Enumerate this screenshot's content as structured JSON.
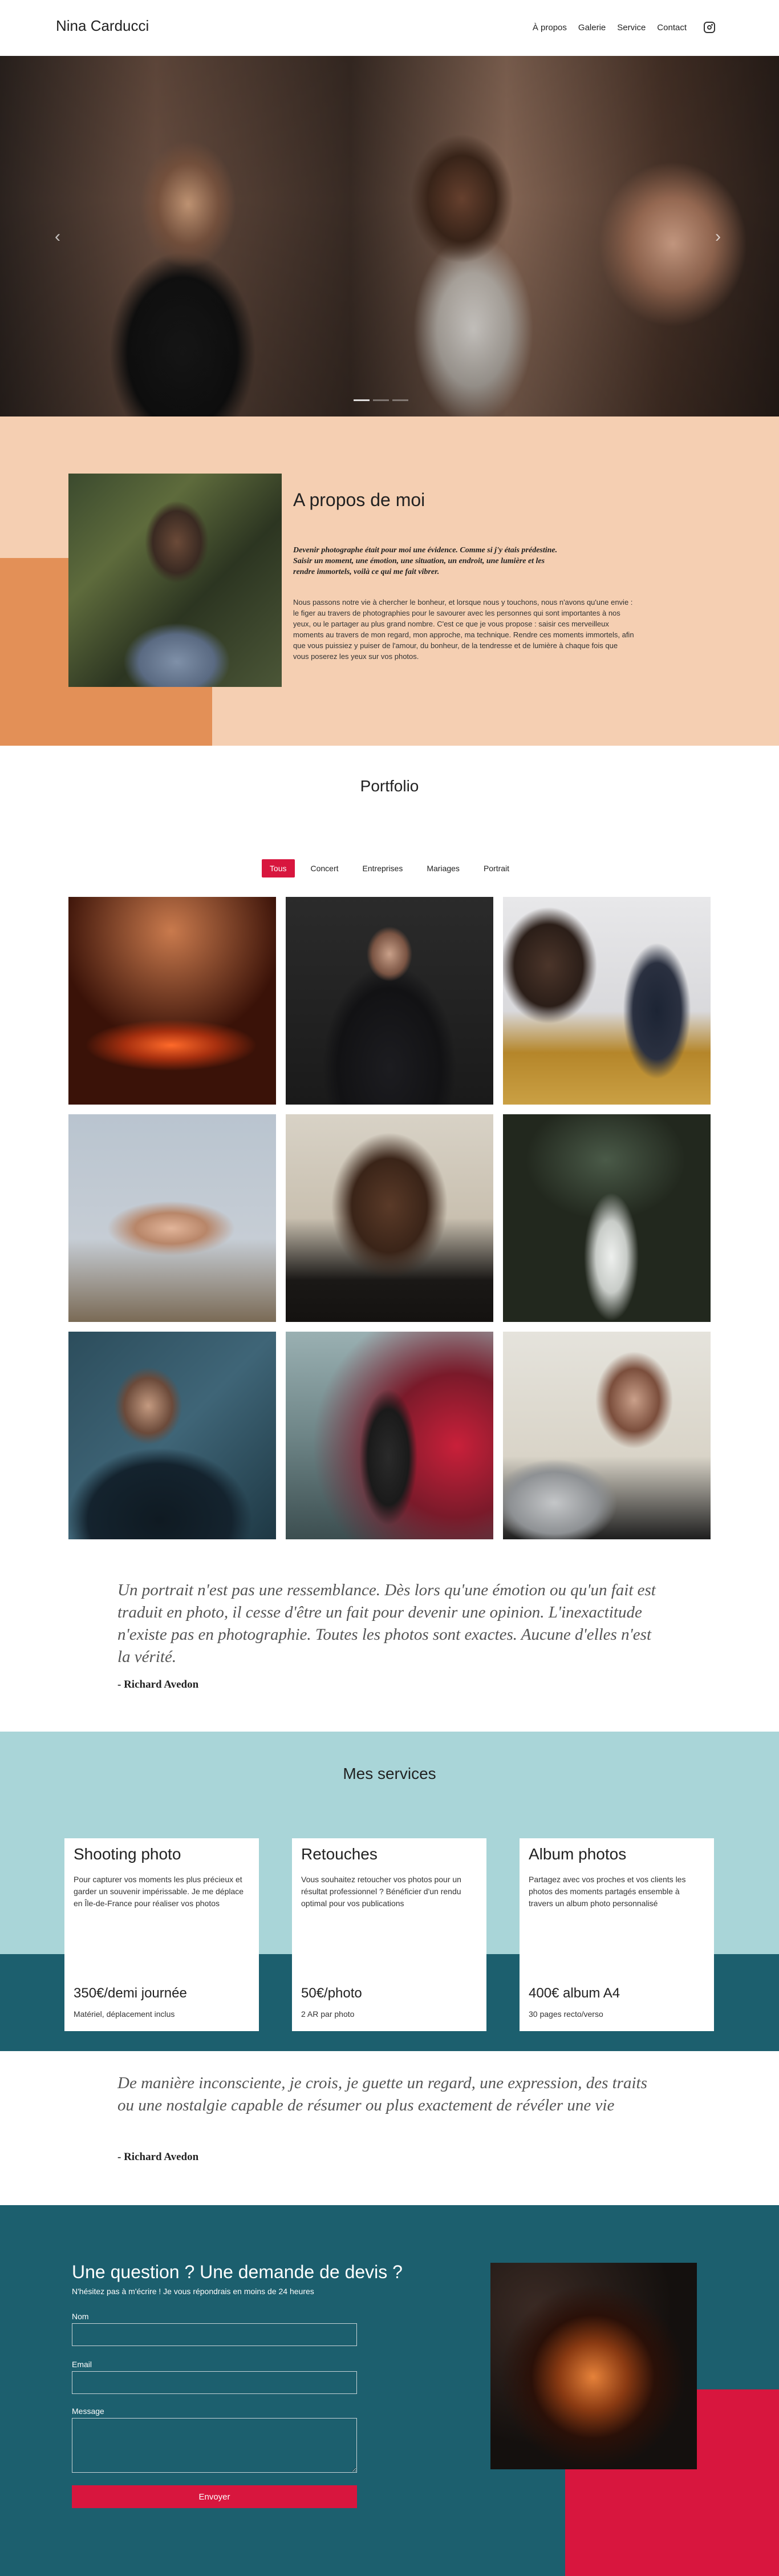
{
  "header": {
    "brand": "Nina Carducci",
    "nav": [
      "À propos",
      "Galerie",
      "Service",
      "Contact"
    ],
    "instagram_icon": "instagram-icon"
  },
  "hero": {
    "prev_icon": "‹",
    "next_icon": "›",
    "slides": 3,
    "active_slide": 1
  },
  "about": {
    "title": "A propos de moi",
    "lead": "Devenir photographe était pour moi une évidence. Comme si j'y étais prédestine. Saisir un moment, une émotion, une situation, un endroit, une lumière et les rendre immortels, voilà ce qui me fait vibrer.",
    "body": "Nous passons notre vie à chercher le bonheur, et lorsque nous y touchons, nous n'avons qu'une envie : le figer au travers de photographies pour le savourer avec les personnes qui sont importantes à nos yeux, ou le partager au plus grand nombre. C'est ce que je vous propose : saisir ces merveilleux moments au travers de mon regard, mon approche, ma technique. Rendre ces moments immortels, afin que vous puissiez y puiser de l'amour, du bonheur, de la tendresse et de lumière à chaque fois que vous poserez les yeux sur vos photos."
  },
  "portfolio": {
    "title": "Portfolio",
    "filters": [
      "Tous",
      "Concert",
      "Entreprises",
      "Mariages",
      "Portrait"
    ],
    "active_filter": "Tous"
  },
  "quote1": {
    "text": "Un portrait n'est pas une ressemblance. Dès lors qu'une émotion ou qu'un fait est traduit en photo, il cesse d'être un fait pour devenir une opinion. L'inexactitude n'existe pas en photographie. Toutes les photos sont exactes. Aucune d'elles n'est la vérité.",
    "author": "- Richard Avedon"
  },
  "services": {
    "title": "Mes services",
    "cards": [
      {
        "title": "Shooting photo",
        "text": "Pour capturer vos moments les plus précieux et garder un souvenir impérissable. Je me déplace en Île-de-France pour réaliser vos photos",
        "price": "350€/demi journée",
        "sub": "Matériel, déplacement inclus"
      },
      {
        "title": "Retouches",
        "text": "Vous souhaitez retoucher vos photos pour un résultat professionnel ? Bénéficier d'un rendu optimal pour vos publications",
        "price": "50€/photo",
        "sub": "2 AR par photo"
      },
      {
        "title": "Album photos",
        "text": "Partagez avec vos proches et vos clients les photos des moments partagés ensemble à travers un album photo personnalisé",
        "price": "400€ album A4",
        "sub": "30 pages recto/verso"
      }
    ]
  },
  "quote2": {
    "text": "De manière inconsciente, je crois, je guette un regard, une expression, des traits ou une nostalgie capable de résumer ou plus exactement de révéler une vie",
    "author": "- Richard Avedon"
  },
  "contact": {
    "title": "Une question ? Une demande de devis ?",
    "subtitle": "N'hésitez pas à m'écrire ! Je vous répondrais en moins de 24 heures",
    "name_label": "Nom",
    "email_label": "Email",
    "message_label": "Message",
    "submit": "Envoyer"
  },
  "colors": {
    "accent": "#d8163e",
    "teal": "#1c5f6e",
    "peach": "#f5cfb2",
    "orange": "#e39057",
    "light_teal": "#a9d5d8"
  }
}
